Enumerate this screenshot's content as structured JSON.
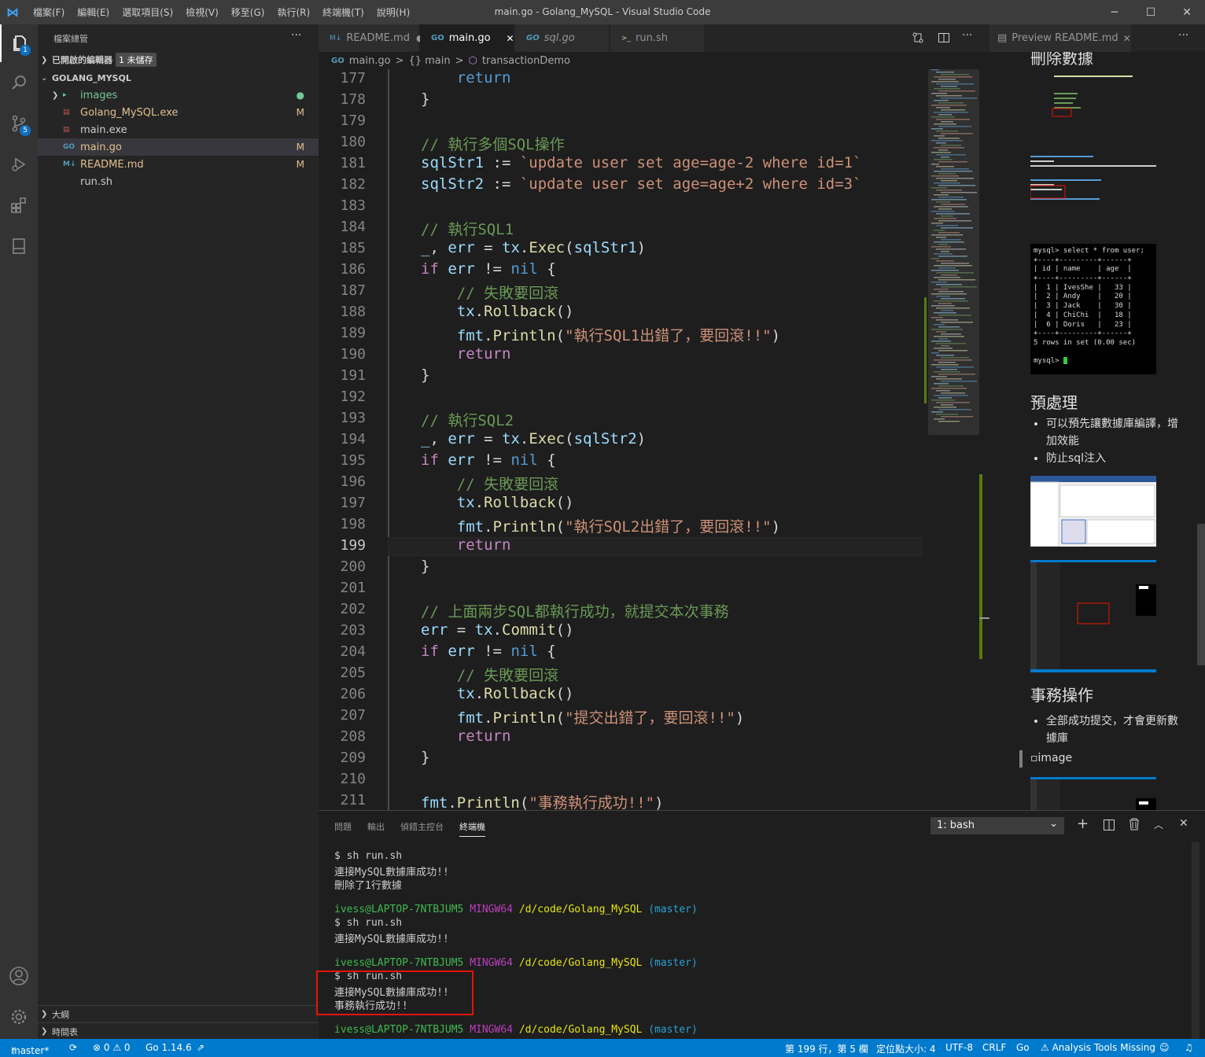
{
  "titlebar": {
    "menu": [
      "檔案(F)",
      "編輯(E)",
      "選取項目(S)",
      "檢視(V)",
      "移至(G)",
      "執行(R)",
      "終端機(T)",
      "說明(H)"
    ],
    "title": "main.go - Golang_MySQL - Visual Studio Code",
    "minimize": "─",
    "maximize": "☐",
    "close": "✕"
  },
  "activity": {
    "explorer_badge": "1",
    "scm_badge": "5"
  },
  "sidebar": {
    "title": "檔案總管",
    "more": "···",
    "open_editors": "已開啟的編輯器",
    "unsaved_badge": "1 未儲存",
    "folder": "GOLANG_MYSQL",
    "files": [
      {
        "name": "images",
        "icon": "▸",
        "status": "●",
        "color": "#73c991"
      },
      {
        "name": "Golang_MySQL.exe",
        "icon": "▤",
        "status": "M",
        "color": "#e2c08d"
      },
      {
        "name": "main.exe",
        "icon": "▤",
        "status": "",
        "color": "#cccccc"
      },
      {
        "name": "main.go",
        "icon": "GO",
        "status": "M",
        "color": "#e2c08d"
      },
      {
        "name": "README.md",
        "icon": "M↓",
        "status": "M",
        "color": "#e2c08d"
      },
      {
        "name": "run.sh",
        "icon": "",
        "status": "",
        "color": "#cccccc"
      }
    ],
    "outline": "大綱",
    "timeline": "時間表"
  },
  "tabs": [
    {
      "label": "README.md",
      "icon": "M↓",
      "close": "●"
    },
    {
      "label": "main.go",
      "icon": "GO",
      "close": "✕"
    },
    {
      "label": "sql.go",
      "icon": "GO",
      "close": ""
    },
    {
      "label": "run.sh",
      "icon": ">_",
      "close": ""
    }
  ],
  "breadcrumb": {
    "file": "main.go",
    "sep": ">",
    "pkg": "{} main",
    "func": "transactionDemo"
  },
  "editor": {
    "lines": [
      {
        "n": "177",
        "t": [
          [
            "k",
            "    return"
          ]
        ]
      },
      {
        "n": "178",
        "t": [
          [
            "p",
            "}"
          ]
        ]
      },
      {
        "n": "179",
        "t": []
      },
      {
        "n": "180",
        "t": [
          [
            "c",
            "// 執行多個SQL操作"
          ]
        ]
      },
      {
        "n": "181",
        "t": [
          [
            "v",
            "sqlStr1"
          ],
          [
            "p",
            " := "
          ],
          [
            "s",
            "`update user set age=age-2 where id=1`"
          ]
        ]
      },
      {
        "n": "182",
        "t": [
          [
            "v",
            "sqlStr2"
          ],
          [
            "p",
            " := "
          ],
          [
            "s",
            "`update user set age=age+2 where id=3`"
          ]
        ]
      },
      {
        "n": "183",
        "t": []
      },
      {
        "n": "184",
        "t": [
          [
            "c",
            "// 執行SQL1"
          ]
        ]
      },
      {
        "n": "185",
        "t": [
          [
            "v",
            "_"
          ],
          [
            "p",
            ", "
          ],
          [
            "v",
            "err"
          ],
          [
            "p",
            " = "
          ],
          [
            "v",
            "tx"
          ],
          [
            "p",
            "."
          ],
          [
            "f",
            "Exec"
          ],
          [
            "p",
            "("
          ],
          [
            "v",
            "sqlStr1"
          ],
          [
            "p",
            ")"
          ]
        ]
      },
      {
        "n": "186",
        "t": [
          [
            "kc",
            "if"
          ],
          [
            "p",
            " "
          ],
          [
            "v",
            "err"
          ],
          [
            "p",
            " != "
          ],
          [
            "k",
            "nil"
          ],
          [
            "p",
            " {"
          ]
        ]
      },
      {
        "n": "187",
        "t": [
          [
            "c",
            "    // 失敗要回滾"
          ]
        ]
      },
      {
        "n": "188",
        "t": [
          [
            "v",
            "    tx"
          ],
          [
            "p",
            "."
          ],
          [
            "f",
            "Rollback"
          ],
          [
            "p",
            "()"
          ]
        ]
      },
      {
        "n": "189",
        "t": [
          [
            "v",
            "    fmt"
          ],
          [
            "p",
            "."
          ],
          [
            "f",
            "Println"
          ],
          [
            "p",
            "("
          ],
          [
            "s",
            "\"執行SQL1出錯了，要回滾!!\""
          ],
          [
            "p",
            ")"
          ]
        ]
      },
      {
        "n": "190",
        "t": [
          [
            "kc",
            "    return"
          ]
        ]
      },
      {
        "n": "191",
        "t": [
          [
            "p",
            "}"
          ]
        ]
      },
      {
        "n": "192",
        "t": []
      },
      {
        "n": "193",
        "t": [
          [
            "c",
            "// 執行SQL2"
          ]
        ]
      },
      {
        "n": "194",
        "t": [
          [
            "v",
            "_"
          ],
          [
            "p",
            ", "
          ],
          [
            "v",
            "err"
          ],
          [
            "p",
            " = "
          ],
          [
            "v",
            "tx"
          ],
          [
            "p",
            "."
          ],
          [
            "f",
            "Exec"
          ],
          [
            "p",
            "("
          ],
          [
            "v",
            "sqlStr2"
          ],
          [
            "p",
            ")"
          ]
        ]
      },
      {
        "n": "195",
        "t": [
          [
            "kc",
            "if"
          ],
          [
            "p",
            " "
          ],
          [
            "v",
            "err"
          ],
          [
            "p",
            " != "
          ],
          [
            "k",
            "nil"
          ],
          [
            "p",
            " {"
          ]
        ]
      },
      {
        "n": "196",
        "t": [
          [
            "c",
            "    // 失敗要回滾"
          ]
        ]
      },
      {
        "n": "197",
        "t": [
          [
            "v",
            "    tx"
          ],
          [
            "p",
            "."
          ],
          [
            "f",
            "Rollback"
          ],
          [
            "p",
            "()"
          ]
        ]
      },
      {
        "n": "198",
        "t": [
          [
            "v",
            "    fmt"
          ],
          [
            "p",
            "."
          ],
          [
            "f",
            "Println"
          ],
          [
            "p",
            "("
          ],
          [
            "s",
            "\"執行SQL2出錯了，要回滾!!\""
          ],
          [
            "p",
            ")"
          ]
        ]
      },
      {
        "n": "199",
        "t": [
          [
            "kc",
            "    return"
          ]
        ]
      },
      {
        "n": "200",
        "t": [
          [
            "p",
            "}"
          ]
        ]
      },
      {
        "n": "201",
        "t": []
      },
      {
        "n": "202",
        "t": [
          [
            "c",
            "// 上面兩步SQL都執行成功，就提交本次事務"
          ]
        ]
      },
      {
        "n": "203",
        "t": [
          [
            "v",
            "err"
          ],
          [
            "p",
            " = "
          ],
          [
            "v",
            "tx"
          ],
          [
            "p",
            "."
          ],
          [
            "f",
            "Commit"
          ],
          [
            "p",
            "()"
          ]
        ]
      },
      {
        "n": "204",
        "t": [
          [
            "kc",
            "if"
          ],
          [
            "p",
            " "
          ],
          [
            "v",
            "err"
          ],
          [
            "p",
            " != "
          ],
          [
            "k",
            "nil"
          ],
          [
            "p",
            " {"
          ]
        ]
      },
      {
        "n": "205",
        "t": [
          [
            "c",
            "    // 失敗要回滾"
          ]
        ]
      },
      {
        "n": "206",
        "t": [
          [
            "v",
            "    tx"
          ],
          [
            "p",
            "."
          ],
          [
            "f",
            "Rollback"
          ],
          [
            "p",
            "()"
          ]
        ]
      },
      {
        "n": "207",
        "t": [
          [
            "v",
            "    fmt"
          ],
          [
            "p",
            "."
          ],
          [
            "f",
            "Println"
          ],
          [
            "p",
            "("
          ],
          [
            "s",
            "\"提交出錯了，要回滾!!\""
          ],
          [
            "p",
            ")"
          ]
        ]
      },
      {
        "n": "208",
        "t": [
          [
            "kc",
            "    return"
          ]
        ]
      },
      {
        "n": "209",
        "t": [
          [
            "p",
            "}"
          ]
        ]
      },
      {
        "n": "210",
        "t": []
      },
      {
        "n": "211",
        "t": [
          [
            "v",
            "fmt"
          ],
          [
            "p",
            "."
          ],
          [
            "f",
            "Println"
          ],
          [
            "p",
            "("
          ],
          [
            "s",
            "\"事務執行成功!!\""
          ],
          [
            "p",
            ")"
          ]
        ]
      }
    ]
  },
  "preview": {
    "tab": "Preview README.md",
    "tab_close": "✕",
    "more": "···",
    "h_delete": "刪除數據",
    "h_prepare": "預處理",
    "prepare_items": [
      "可以預先讓數據庫編譯，增加效能",
      "防止sql注入"
    ],
    "h_tx": "事務操作",
    "tx_items": [
      "全部成功提交，才會更新數據庫"
    ],
    "img_alt": "image",
    "mysql": [
      "mysql> select * from user;",
      "+----+---------+------+",
      "| id | name    | age  |",
      "+----+---------+------+",
      "|  1 | IvesShe |   33 |",
      "|  2 | Andy    |   20 |",
      "|  3 | Jack    |   30 |",
      "|  4 | ChiChi  |   18 |",
      "|  6 | Doris   |   23 |",
      "+----+---------+------+",
      "5 rows in set (0.00 sec)",
      "",
      "mysql> "
    ]
  },
  "panel": {
    "tabs": [
      "問題",
      "輸出",
      "偵錯主控台",
      "終端機"
    ],
    "terminal_select": "1: bash",
    "term": [
      {
        "t": "$ sh run.sh"
      },
      {
        "t": "連接MySQL數據庫成功!!"
      },
      {
        "t": "刪除了1行數據"
      },
      {
        "t": ""
      },
      {
        "prompt": true
      },
      {
        "t": "$ sh run.sh"
      },
      {
        "t": "連接MySQL數據庫成功!!"
      },
      {
        "t": ""
      },
      {
        "prompt": true
      },
      {
        "t": "$ sh run.sh"
      },
      {
        "t": "連接MySQL數據庫成功!!"
      },
      {
        "t": "事務執行成功!!"
      },
      {
        "t": ""
      },
      {
        "prompt": true
      }
    ],
    "prompt_user": "ivess@LAPTOP-7NTBJUM5",
    "prompt_env": "MINGW64",
    "prompt_path": "/d/code/Golang_MySQL",
    "prompt_branch": "(master)"
  },
  "status": {
    "branch": "master*",
    "sync": "⟳",
    "problems": "⊗ 0 ⚠ 0",
    "go": "Go 1.14.6",
    "position": "第 199 行，第 5 欄",
    "tab": "定位點大小: 4",
    "encoding": "UTF-8",
    "eol": "CRLF",
    "lang": "Go",
    "warn": "⚠ Analysis Tools Missing"
  },
  "colors": {
    "accent": "#007acc",
    "highlight": "#e51400"
  }
}
